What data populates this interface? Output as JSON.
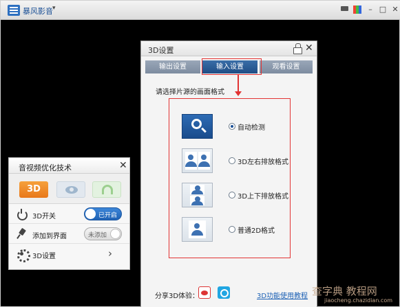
{
  "app": {
    "title": "暴风影音",
    "caret": "▾",
    "window_controls": {
      "minimize": "–",
      "maximize": "□",
      "close": "✕"
    }
  },
  "dialog_3d": {
    "title": "3D设置",
    "close": "✕",
    "tabs": [
      {
        "label": "输出设置",
        "selected": false
      },
      {
        "label": "输入设置",
        "selected": true
      },
      {
        "label": "观看设置",
        "selected": false
      }
    ],
    "prompt": "请选择片源的画面格式",
    "options": [
      {
        "label": "自动检测",
        "checked": true,
        "icon": "search-icon"
      },
      {
        "label": "3D左右排放格式",
        "checked": false,
        "icon": "side-by-side-icon"
      },
      {
        "label": "3D上下排放格式",
        "checked": false,
        "icon": "top-bottom-icon"
      },
      {
        "label": "普通2D格式",
        "checked": false,
        "icon": "single-person-icon"
      }
    ],
    "share_label": "分享3D体验：",
    "guide_link": "3D功能使用教程"
  },
  "panel": {
    "title": "音视频优化技术",
    "close": "✕",
    "tabs": [
      "3D",
      "eye-icon",
      "headphones-icon"
    ],
    "rows": [
      {
        "label": "3D开关",
        "control": "已开启"
      },
      {
        "label": "添加到界面",
        "control": "未添加"
      },
      {
        "label": "3D设置",
        "control": "›"
      }
    ]
  },
  "watermark": {
    "main": "查字典 教程网",
    "site": "jiaocheng.chazidian.com"
  },
  "colors": {
    "accent": "#1f4d85",
    "highlight": "#e23232",
    "orange": "#e8781b"
  }
}
